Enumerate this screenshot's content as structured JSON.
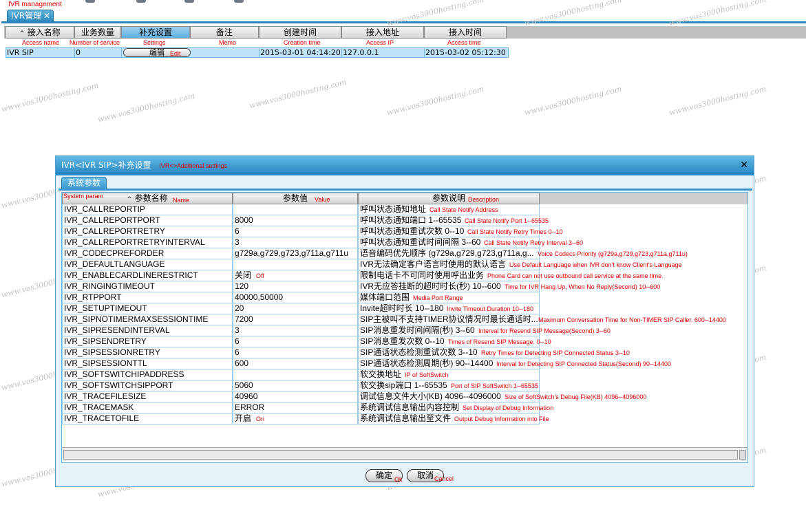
{
  "annotations": {
    "ivr_management": "IVR management",
    "col_access_name": "Access name",
    "col_number_of_service": "Number of service",
    "col_settings": "Settings",
    "col_memo": "Memo",
    "col_creation_time": "Creation time",
    "col_access_ip": "Access IP",
    "col_access_time": "Access time",
    "edit": "Edit",
    "dialog_title": "IVR<>Additional settings",
    "system_param": "System param",
    "name": "Name",
    "value": "Value",
    "description": "Description",
    "ok": "Ok",
    "cancel": "Cancel"
  },
  "main_tab": {
    "label": "IVR管理",
    "close": "✕"
  },
  "grid": {
    "columns": [
      "接入名称",
      "业务数量",
      "补充设置",
      "备注",
      "创建时间",
      "接入地址",
      "接入时间"
    ],
    "sort_arrow": "^",
    "row": {
      "access_name": "IVR SIP",
      "number_of_service": "0",
      "settings_button": "编辑",
      "memo": "",
      "creation_time": "2015-03-01 04:14:20",
      "access_ip": "127.0.0.1",
      "access_time": "2015-03-02 05:12:30"
    }
  },
  "watermark": "www.vos3000hosting.com",
  "dialog": {
    "title": "IVR<IVR SIP>补充设置",
    "close": "✕",
    "tab": "系统参数",
    "columns": {
      "name": "参数名称",
      "value": "参数值",
      "description": "参数说明"
    },
    "rows": [
      {
        "name": "IVR_CALLREPORTIP",
        "value": "",
        "desc": "呼叫状态通知地址",
        "ann": "Call State Notify Address"
      },
      {
        "name": "IVR_CALLREPORTPORT",
        "value": "8000",
        "desc": "呼叫状态通知端口 1--65535",
        "ann": "Call State Notify Port 1--65535"
      },
      {
        "name": "IVR_CALLREPORTRETRY",
        "value": "6",
        "desc": "呼叫状态通知重试次数 0--10",
        "ann": "Call State Notify Retry Times 0--10"
      },
      {
        "name": "IVR_CALLREPORTRETRYINTERVAL",
        "value": "3",
        "desc": "呼叫状态通知重试时间间隔 3--60",
        "ann": "Call State Notify Retry Interval 3--60"
      },
      {
        "name": "IVR_CODECPREFORDER",
        "value": "g729a,g729,g723,g711a,g711u",
        "desc": "语音编码优先顺序 (g729a,g729,g723,g711a,g...",
        "ann": "Voice Codecs Priority (g729a,g729,g723,g711a,g711u)"
      },
      {
        "name": "IVR_DEFAULTLANGUAGE",
        "value": "",
        "desc": "IVR无法确定客户语言时使用的默认语言",
        "ann": "Use Default Language when IVR don't know Client's Language"
      },
      {
        "name": "IVR_ENABLECARDLINERESTRICT",
        "value": "关闭",
        "value_ann": "Off",
        "desc": "限制电话卡不可同时使用呼出业务",
        "ann": "Phone Card can not use outbound call service at the same time."
      },
      {
        "name": "IVR_RINGINGTIMEOUT",
        "value": "120",
        "desc": "IVR无应答挂断的超时时长(秒) 10--600",
        "ann": "Time for IVR Hang Up, When No Reply(Second) 10--600"
      },
      {
        "name": "IVR_RTPPORT",
        "value": "40000,50000",
        "desc": "媒体端口范围",
        "ann": "Media Port Range"
      },
      {
        "name": "IVR_SETUPTIMEOUT",
        "value": "20",
        "desc": "Invite超时时长 10--180",
        "ann": "Invite Timeout Duration 10--180"
      },
      {
        "name": "IVR_SIPNOTIMERMAXSESSIONTIME",
        "value": "7200",
        "desc": "SIP主被叫不支持TIMER协议情况时最长通话时...",
        "ann": "Maximum Conversation Time for Non-TIMER SIP Caller. 600--14400"
      },
      {
        "name": "IVR_SIPRESENDINTERVAL",
        "value": "3",
        "desc": "SIP消息重发时间间隔(秒) 3--60",
        "ann": "Interval for Resend SIP Message(Second) 3--60"
      },
      {
        "name": "IVR_SIPSENDRETRY",
        "value": "6",
        "desc": "SIP消息重发次数 0--10",
        "ann": "Times of Resend SIP Message. 0--10"
      },
      {
        "name": "IVR_SIPSESSIONRETRY",
        "value": "6",
        "desc": "SIP通话状态检测重试次数 3--10",
        "ann": "Retry Times for Detecting SIP Connected Status 3--10"
      },
      {
        "name": "IVR_SIPSESSIONTTL",
        "value": "600",
        "desc": "SIP通话状态检测周期(秒) 90--14400",
        "ann": "Interval for Detecting SIP Connected Status(Second) 90--14400"
      },
      {
        "name": "IVR_SOFTSWITCHIPADDRESS",
        "value": "",
        "desc": "软交换地址",
        "ann": "IP of SoftSwitch"
      },
      {
        "name": "IVR_SOFTSWITCHSIPPORT",
        "value": "5060",
        "desc": "软交换sip端口 1--65535",
        "ann": "Port of SIP SoftSwitch 1--65535"
      },
      {
        "name": "IVR_TRACEFILESIZE",
        "value": "40960",
        "desc": "调试信息文件大小(KB) 4096--4096000",
        "ann": "Size of SoftSwitch's Debug File(KB) 4096--4096000"
      },
      {
        "name": "IVR_TRACEMASK",
        "value": "ERROR",
        "desc": "系统调试信息输出内容控制",
        "ann": "Set Display of Debug Information"
      },
      {
        "name": "IVR_TRACETOFILE",
        "value": "开启",
        "value_ann": "On",
        "desc": "系统调试信息输出至文件",
        "ann": "Output Debug Information into File"
      }
    ],
    "ok_button": "确定",
    "cancel_button": "取消"
  }
}
